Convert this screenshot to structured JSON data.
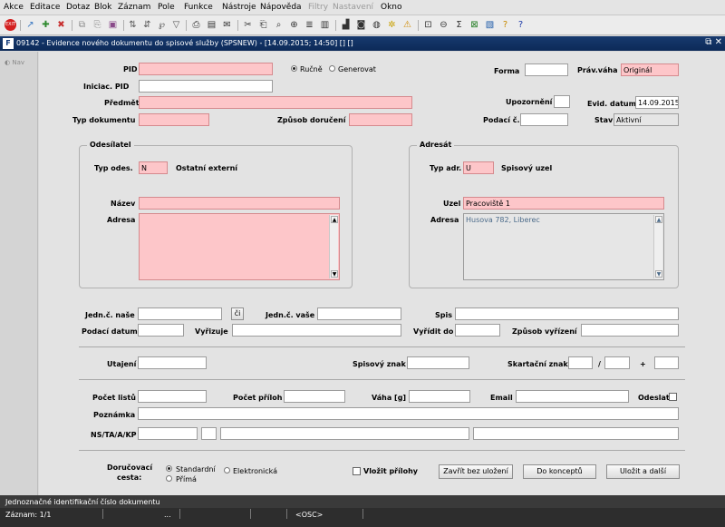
{
  "menu": [
    "Akce",
    "Editace",
    "Dotaz",
    "Blok",
    "Záznam",
    "Pole",
    "Funkce",
    "Nástroje",
    "Nápověda",
    "Filtry",
    "Nastavení",
    "Okno"
  ],
  "menu_disabled": [
    false,
    false,
    false,
    false,
    false,
    false,
    false,
    false,
    false,
    true,
    true,
    false
  ],
  "window": {
    "title": "09142 - Evidence nového dokumentu do spisové služby (SPSNEW) - [14.09.2015; 14:50] [] []",
    "logo": "F",
    "controls": "⧉ ✕"
  },
  "nav": {
    "label": "Nav"
  },
  "header": {
    "pid_label": "PID",
    "pid_value": "",
    "mode_manual": "Ručně",
    "mode_generate": "Generovat",
    "iniciac_label": "Iniciac. PID",
    "iniciac_value": "",
    "predmet_label": "Předmět",
    "predmet_value": "",
    "typ_dok_label": "Typ dokumentu",
    "typ_dok_value": "",
    "zpusob_doruceni_label": "Způsob doručení",
    "zpusob_doruceni_value": "",
    "forma_label": "Forma",
    "forma_value": "",
    "prav_vaha_label": "Práv.váha",
    "prav_vaha_value": "Originál",
    "upozorneni_label": "Upozornění",
    "evid_datum_label": "Evid. datum",
    "evid_datum_value": "14.09.2015",
    "podaci_label": "Podací č.",
    "podaci_value": "",
    "stav_label": "Stav",
    "stav_value": "Aktivní"
  },
  "odesilatel": {
    "title": "Odesílatel",
    "typ_label": "Typ odes.",
    "typ_value": "N",
    "typ_desc": "Ostatní externí",
    "nazev_label": "Název",
    "nazev_value": "",
    "adresa_label": "Adresa",
    "adresa_value": ""
  },
  "adresat": {
    "title": "Adresát",
    "typ_label": "Typ adr.",
    "typ_value": "U",
    "typ_desc": "Spisový uzel",
    "uzel_label": "Uzel",
    "uzel_value": "Pracoviště 1",
    "adresa_label": "Adresa",
    "adresa_value": "Husova 782, Liberec"
  },
  "jednaci": {
    "nase_label": "Jedn.č. naše",
    "nase_value": "",
    "lookup_label": "či",
    "vase_label": "Jedn.č. vaše",
    "vase_value": "",
    "spis_label": "Spis",
    "spis_value": "",
    "podaci_datum_label": "Podací datum",
    "podaci_datum_value": "",
    "vyrizuje_label": "Vyřizuje",
    "vyrizuje_value": "",
    "vyridit_do_label": "Vyřídit do",
    "vyridit_do_value": "",
    "zpusob_vyrizeni_label": "Způsob vyřízení",
    "zpusob_vyrizeni_value": ""
  },
  "utajeni": {
    "label": "Utajení",
    "value": "",
    "spisovy_znak_label": "Spisový znak",
    "spisovy_znak_value": "",
    "skartacni_label": "Skartační znak",
    "sep1": "/",
    "sep2": "+"
  },
  "pocty": {
    "listu_label": "Počet listů",
    "priloh_label": "Počet příloh",
    "vaha_label": "Váha [g]",
    "email_label": "Email",
    "odeslat_label": "Odeslat",
    "poznamka_label": "Poznámka",
    "ns_label": "NS/TA/A/KP"
  },
  "footer": {
    "doruc_label_1": "Doručovací",
    "doruc_label_2": "cesta:",
    "opt_standard": "Standardní",
    "opt_elektronicka": "Elektronická",
    "opt_prima": "Přímá",
    "vlozit_label": "Vložit přílohy",
    "btn_close": "Zavřít bez uložení",
    "btn_draft": "Do konceptů",
    "btn_save_next": "Uložit a další"
  },
  "status": {
    "hint": "Jednoznačné identifikační číslo dokumentu",
    "record": "Záznam: 1/1",
    "dots": "...",
    "osc": "<OSC>"
  },
  "colors": {
    "required": "#fdc6c9",
    "titlebar": "#173a6e",
    "status": "#2d2d2d"
  }
}
